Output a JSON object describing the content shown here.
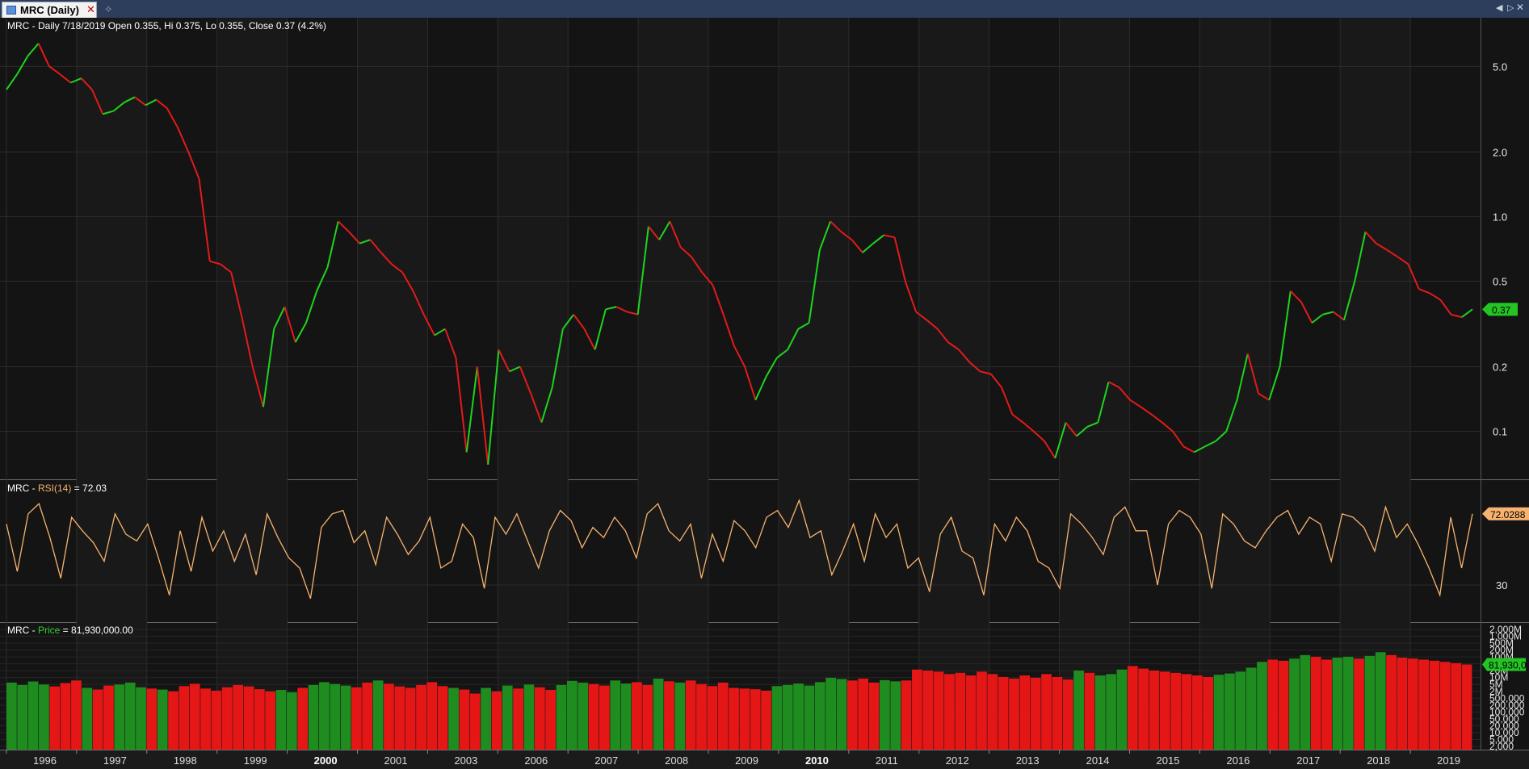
{
  "window": {
    "tab_title": "MRC (Daily)",
    "tab_close": "✕",
    "new_tab": "⟡",
    "nav_left": "◀",
    "nav_right": "▷",
    "nav_close": "✕"
  },
  "colors": {
    "up": "#1ed41e",
    "down": "#e41a1a",
    "rsi": "#f7b36f",
    "volume_up": "#1f8c1f",
    "volume_down": "#e51616",
    "background": "#141414",
    "grid": "#2c2c2c",
    "price_badge": "#23c423",
    "rsi_badge": "#f7b36f"
  },
  "legends": {
    "price": "MRC - Daily 7/18/2019 Open 0.355, Hi 0.375, Lo 0.355, Close 0.37 (4.2%)",
    "rsi_prefix": "MRC - ",
    "rsi_name": "RSI(14)",
    "rsi_suffix": " = 72.03",
    "vol_prefix": "MRC - ",
    "vol_name": "Price",
    "vol_suffix": " = 81,930,000.00"
  },
  "chart_data": [
    {
      "type": "line",
      "panel": "price",
      "scale": "log",
      "ylim": [
        0.063,
        8.0
      ],
      "y_ticks": [
        {
          "v": 5.0,
          "label": "5.0"
        },
        {
          "v": 2.0,
          "label": "2.0"
        },
        {
          "v": 1.0,
          "label": "1.0"
        },
        {
          "v": 0.5,
          "label": "0.5"
        },
        {
          "v": 0.2,
          "label": "0.2"
        },
        {
          "v": 0.1,
          "label": "0.1"
        }
      ],
      "last_value_label": "0.37",
      "x_labels": [
        "1996",
        "1997",
        "1998",
        "1999",
        "2000",
        "2001",
        "2003",
        "2006",
        "2007",
        "2008",
        "2009",
        "2010",
        "2011",
        "2012",
        "2013",
        "2014",
        "2015",
        "2016",
        "2017",
        "2018",
        "2019"
      ],
      "series": [
        {
          "values": [
            3.9,
            4.6,
            5.6,
            6.4,
            5.0,
            4.6,
            4.2,
            4.4,
            3.9,
            3.0,
            3.1,
            3.4,
            3.6,
            3.3,
            3.5,
            3.2,
            2.6,
            2.0,
            1.5,
            0.62,
            0.6,
            0.55,
            0.34,
            0.2,
            0.13,
            0.3,
            0.38,
            0.26,
            0.32,
            0.45,
            0.58,
            0.95,
            0.85,
            0.75,
            0.78,
            0.68,
            0.6,
            0.55,
            0.45,
            0.35,
            0.28,
            0.3,
            0.22,
            0.08,
            0.2,
            0.07,
            0.24,
            0.19,
            0.2,
            0.15,
            0.11,
            0.16,
            0.3,
            0.35,
            0.3,
            0.24,
            0.37,
            0.38,
            0.36,
            0.35,
            0.9,
            0.78,
            0.95,
            0.72,
            0.65,
            0.55,
            0.48,
            0.35,
            0.25,
            0.2,
            0.14,
            0.18,
            0.22,
            0.24,
            0.3,
            0.32,
            0.7,
            0.95,
            0.85,
            0.78,
            0.68,
            0.75,
            0.82,
            0.8,
            0.5,
            0.36,
            0.33,
            0.3,
            0.26,
            0.24,
            0.21,
            0.19,
            0.185,
            0.16,
            0.12,
            0.11,
            0.1,
            0.09,
            0.075,
            0.11,
            0.095,
            0.105,
            0.11,
            0.17,
            0.16,
            0.14,
            0.13,
            0.12,
            0.11,
            0.1,
            0.085,
            0.08,
            0.085,
            0.09,
            0.1,
            0.14,
            0.23,
            0.15,
            0.14,
            0.2,
            0.45,
            0.4,
            0.32,
            0.35,
            0.36,
            0.33,
            0.5,
            0.85,
            0.75,
            0.7,
            0.65,
            0.6,
            0.46,
            0.44,
            0.41,
            0.35,
            0.34,
            0.37
          ]
        }
      ]
    },
    {
      "type": "line",
      "panel": "rsi",
      "name": "RSI(14)",
      "ylim": [
        10,
        90
      ],
      "y_ticks": [
        {
          "v": 30,
          "label": "30"
        }
      ],
      "last_value_label": "72.0288",
      "series": [
        {
          "name": "RSI(14)",
          "values": [
            66,
            38,
            72,
            78,
            58,
            34,
            70,
            62,
            55,
            44,
            72,
            60,
            56,
            66,
            46,
            24,
            62,
            38,
            70,
            50,
            62,
            44,
            60,
            36,
            72,
            58,
            46,
            40,
            22,
            64,
            72,
            74,
            55,
            62,
            42,
            70,
            60,
            48,
            56,
            70,
            40,
            44,
            66,
            58,
            28,
            70,
            60,
            72,
            56,
            40,
            62,
            74,
            68,
            52,
            64,
            58,
            70,
            62,
            46,
            72,
            78,
            62,
            56,
            66,
            34,
            60,
            44,
            68,
            62,
            52,
            70,
            74,
            64,
            80,
            58,
            62,
            36,
            50,
            66,
            44,
            72,
            58,
            66,
            40,
            46,
            26,
            60,
            70,
            50,
            46,
            24,
            66,
            56,
            70,
            62,
            44,
            40,
            28,
            72,
            66,
            58,
            48,
            70,
            76,
            62,
            62,
            30,
            66,
            74,
            70,
            60,
            28,
            72,
            66,
            56,
            52,
            62,
            70,
            74,
            60,
            70,
            66,
            44,
            72,
            70,
            64,
            50,
            76,
            58,
            66,
            54,
            40,
            24,
            70,
            40,
            72
          ]
        }
      ]
    },
    {
      "type": "bar",
      "panel": "volume",
      "name": "Price",
      "scale": "log",
      "ylim": [
        1000,
        2500000
      ],
      "y_ticks": [
        {
          "v": 2000000,
          "label": "2,000M"
        },
        {
          "v": 1000000,
          "label": "1,000M"
        },
        {
          "v": 500000,
          "label": "500M"
        },
        {
          "v": 200000,
          "label": "200M"
        },
        {
          "v": 100000,
          "label": "100M"
        },
        {
          "v": 50000,
          "label": "50M"
        },
        {
          "v": 20000,
          "label": "20M"
        },
        {
          "v": 10000,
          "label": "10M"
        },
        {
          "v": 5000,
          "label": "5M"
        },
        {
          "v": 2000,
          "label": "2M"
        },
        {
          "v": 500,
          "label": "500,000"
        },
        {
          "v": 200,
          "label": "200,000"
        },
        {
          "v": 100,
          "label": "100,000"
        },
        {
          "v": 50,
          "label": "50,000"
        },
        {
          "v": 20,
          "label": "20,000"
        },
        {
          "v": 10,
          "label": "10,000"
        },
        {
          "v": 5,
          "label": "5,000"
        },
        {
          "v": 2,
          "label": "2,000"
        }
      ],
      "last_value_label": "81,930,0",
      "series": [
        {
          "name": "Price",
          "values": [
            70000,
            60000,
            75000,
            62000,
            55000,
            68000,
            80000,
            50000,
            45000,
            58000,
            62000,
            70000,
            52000,
            48000,
            45000,
            40000,
            56000,
            65000,
            48000,
            42000,
            52000,
            60000,
            55000,
            46000,
            40000,
            44000,
            38000,
            50000,
            60000,
            72000,
            64000,
            58000,
            52000,
            70000,
            80000,
            65000,
            55000,
            50000,
            60000,
            72000,
            56000,
            50000,
            45000,
            35000,
            50000,
            40000,
            58000,
            48000,
            62000,
            52000,
            44000,
            60000,
            78000,
            70000,
            64000,
            58000,
            80000,
            66000,
            72000,
            60000,
            90000,
            76000,
            70000,
            80000,
            64000,
            56000,
            70000,
            50000,
            48000,
            46000,
            42000,
            56000,
            60000,
            66000,
            58000,
            72000,
            95000,
            88000,
            80000,
            90000,
            70000,
            82000,
            76000,
            80000,
            160000,
            150000,
            140000,
            120000,
            130000,
            110000,
            140000,
            120000,
            100000,
            90000,
            110000,
            95000,
            120000,
            100000,
            85000,
            150000,
            130000,
            110000,
            120000,
            160000,
            200000,
            170000,
            150000,
            140000,
            130000,
            120000,
            110000,
            100000,
            115000,
            125000,
            140000,
            180000,
            260000,
            300000,
            280000,
            320000,
            400000,
            360000,
            300000,
            340000,
            360000,
            320000,
            380000,
            480000,
            400000,
            340000,
            320000,
            300000,
            280000,
            260000,
            240000,
            220000
          ]
        }
      ]
    }
  ]
}
